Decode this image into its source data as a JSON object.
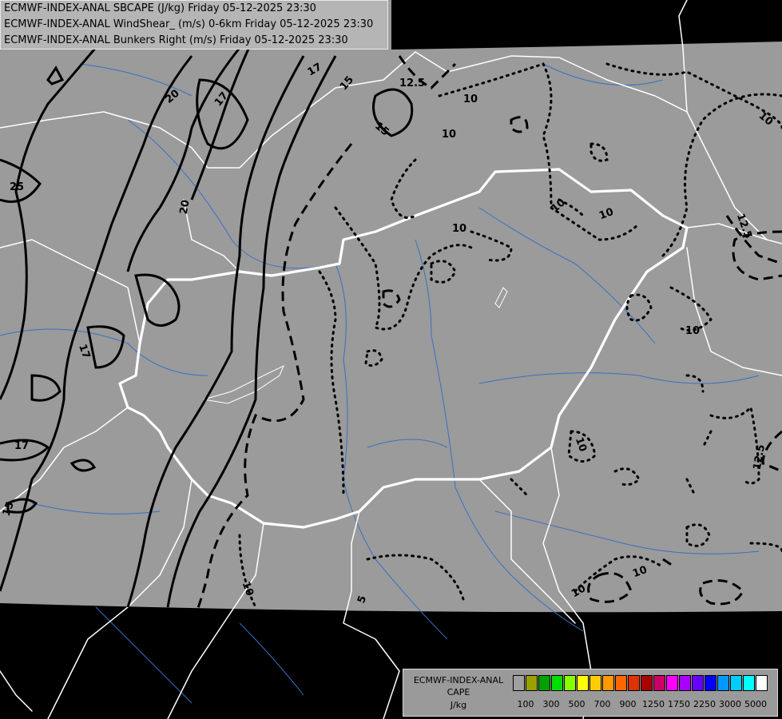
{
  "title_lines": [
    "ECMWF-INDEX-ANAL SBCAPE (J/kg) Friday 05-12-2025 23:30",
    "ECMWF-INDEX-ANAL WindShear_ (m/s) 0-6km Friday 05-12-2025 23:30",
    "ECMWF-INDEX-ANAL Bunkers Right (m/s) Friday 05-12-2025 23:30"
  ],
  "legend": {
    "title_lines": [
      "ECMWF-INDEX-ANAL",
      "CAPE",
      "J/kg"
    ],
    "colors": [
      "#a0a0a0",
      "#9aa000",
      "#00a000",
      "#00dd00",
      "#88ff00",
      "#ffff00",
      "#ffcc00",
      "#ff9900",
      "#ff6600",
      "#dd3300",
      "#aa0000",
      "#cc0066",
      "#ff00ff",
      "#aa00ff",
      "#6600ff",
      "#0000ff",
      "#0099ff",
      "#00ccff",
      "#00ffff",
      "#ffffff"
    ],
    "tick_labels": [
      "100",
      "300",
      "500",
      "700",
      "900",
      "1250",
      "1750",
      "2250",
      "3000",
      "5000"
    ]
  },
  "contour_labels": [
    {
      "text": "20"
    },
    {
      "text": "17"
    },
    {
      "text": "17"
    },
    {
      "text": "15"
    },
    {
      "text": "12.5"
    },
    {
      "text": "15"
    },
    {
      "text": "10"
    },
    {
      "text": "10"
    },
    {
      "text": "10"
    },
    {
      "text": "10"
    },
    {
      "text": "10"
    },
    {
      "text": "10"
    },
    {
      "text": "25"
    },
    {
      "text": "20"
    },
    {
      "text": "17"
    },
    {
      "text": "17"
    },
    {
      "text": "15"
    },
    {
      "text": "12.5"
    },
    {
      "text": "10"
    },
    {
      "text": "12.5"
    },
    {
      "text": "10"
    },
    {
      "text": "10"
    },
    {
      "text": "10"
    },
    {
      "text": "10"
    },
    {
      "text": "5"
    }
  ],
  "colors": {
    "map_fill": "#9b9b9b",
    "outside": "#000000",
    "border": "#ffffff",
    "river": "#3a6fc4",
    "contour": "#000000"
  }
}
